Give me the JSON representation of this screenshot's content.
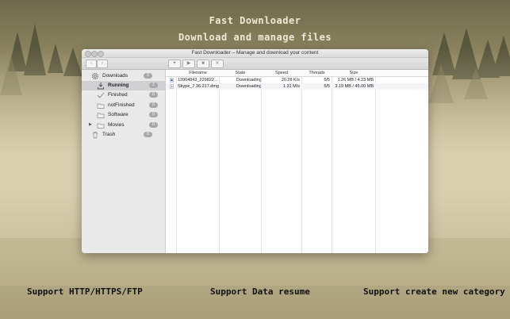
{
  "promo": {
    "title": "Fast Downloader",
    "subtitle": "Download and manage files",
    "features": [
      "Support HTTP/HTTPS/FTP",
      "Support Data resume",
      "Support create new category"
    ]
  },
  "window": {
    "title": "Fast Downloader – Manage and download your content",
    "toolbar": {
      "back_icon": "chevron-left-icon",
      "forward_icon": "chevron-right-icon",
      "add_label": "+",
      "pause_icon": "pause-icon",
      "stop_icon": "stop-icon",
      "remove_label": "✕"
    }
  },
  "sidebar": {
    "items": [
      {
        "label": "Downloads",
        "icon": "gear-icon",
        "count": "2"
      },
      {
        "label": "Running",
        "icon": "download-icon",
        "count": "2"
      },
      {
        "label": "Finished",
        "icon": "checkmark-icon",
        "count": "0"
      },
      {
        "label": "notFinished",
        "icon": "folder-icon",
        "count": "0"
      },
      {
        "label": "Software",
        "icon": "folder-icon",
        "count": "0"
      },
      {
        "label": "Movies",
        "icon": "folder-icon",
        "count": "0"
      },
      {
        "label": "Trash",
        "icon": "trash-icon",
        "count": "0"
      }
    ]
  },
  "table": {
    "columns": [
      "Filename",
      "State",
      "Speed",
      "Threads",
      "Size"
    ],
    "rows": [
      {
        "filename": "13904843_229822...",
        "state": "Downloading",
        "speed": "20.28 K/s",
        "threads": "5/5",
        "size": "1.26 MB / 4.23 MB"
      },
      {
        "filename": "Skype_7.36.217.dmg",
        "state": "Downloading",
        "speed": "1.31 M/s",
        "threads": "5/5",
        "size": "3.19 MB / 45.00 MB"
      }
    ]
  }
}
